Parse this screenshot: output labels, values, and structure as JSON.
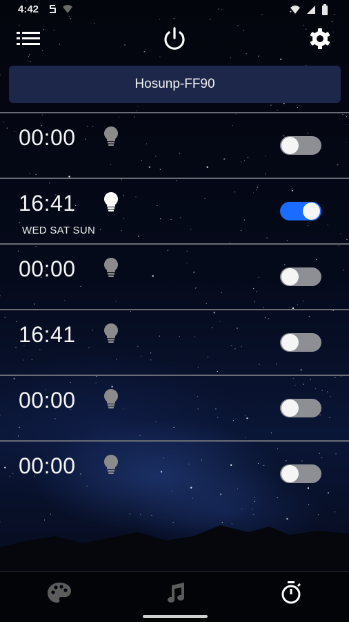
{
  "status_bar": {
    "time": "4:42",
    "icons": [
      "sync-icon",
      "wifi-icon",
      "signal-icon",
      "battery-icon"
    ]
  },
  "top_bar": {
    "icons": [
      "menu-icon",
      "power-icon",
      "gear-icon"
    ]
  },
  "device": {
    "name": "Hosunp-FF90"
  },
  "alarms": [
    {
      "time": "00:00",
      "days": "",
      "enabled": false,
      "bulb_lit": false
    },
    {
      "time": "16:41",
      "days": "WED SAT SUN",
      "enabled": true,
      "bulb_lit": true
    },
    {
      "time": "00:00",
      "days": "",
      "enabled": false,
      "bulb_lit": false
    },
    {
      "time": "16:41",
      "days": "",
      "enabled": false,
      "bulb_lit": false
    },
    {
      "time": "00:00",
      "days": "",
      "enabled": false,
      "bulb_lit": false
    },
    {
      "time": "00:00",
      "days": "",
      "enabled": false,
      "bulb_lit": false
    }
  ],
  "bottom_nav": {
    "items": [
      {
        "icon": "palette-icon",
        "active": false
      },
      {
        "icon": "music-note-icon",
        "active": false
      },
      {
        "icon": "timer-icon",
        "active": true
      }
    ]
  },
  "colors": {
    "accent": "#1a6bff",
    "device_bar": "#1c2749",
    "toggle_off": "#8d8f95",
    "divider": "#6a6d76"
  }
}
